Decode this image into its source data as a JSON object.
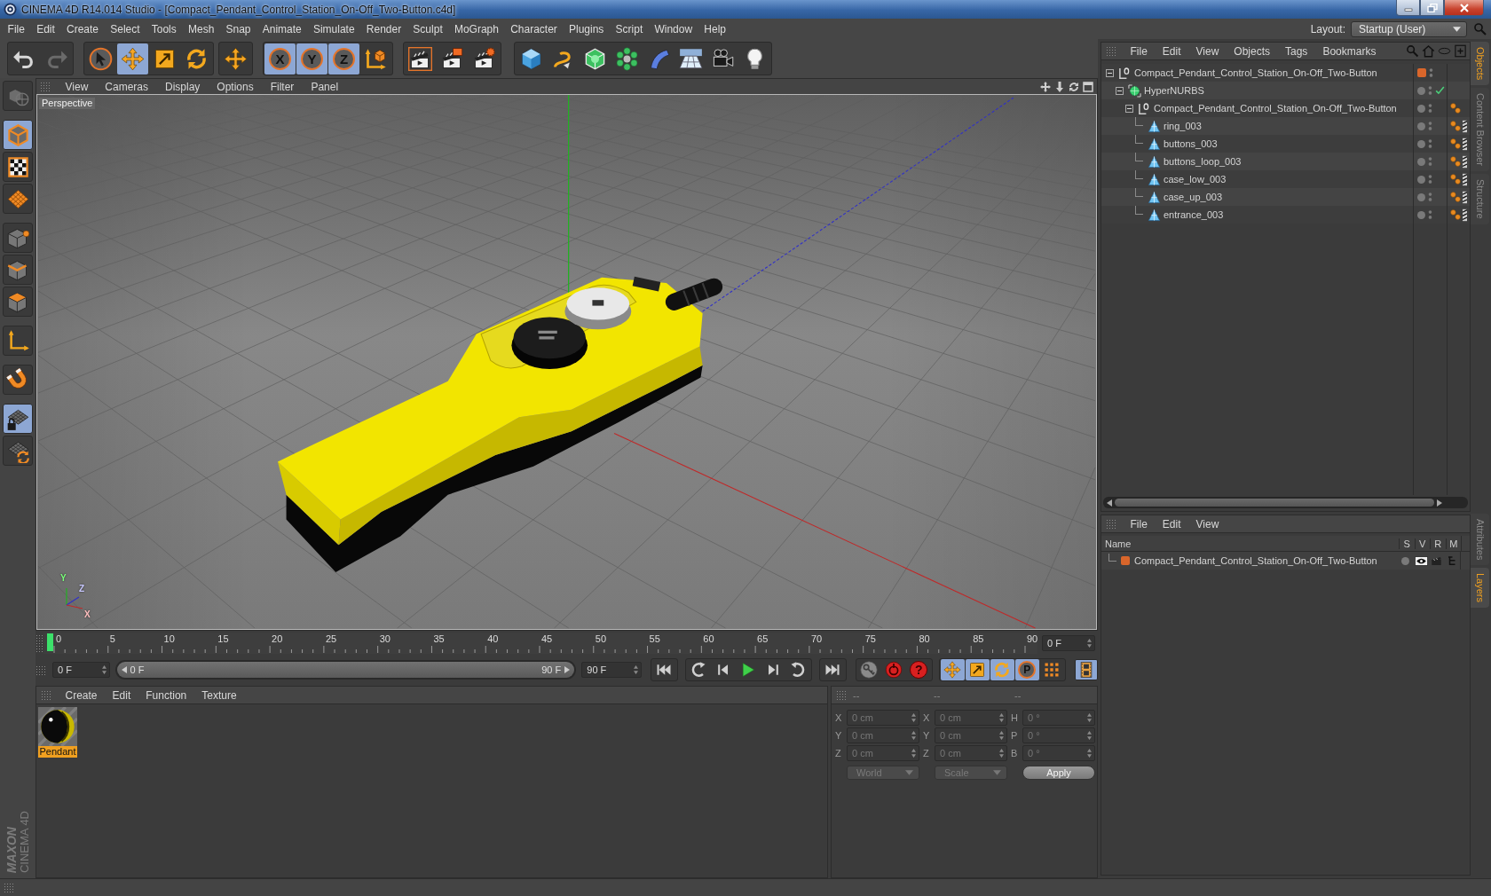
{
  "title_bar": {
    "title": "CINEMA 4D R14.014 Studio - [Compact_Pendant_Control_Station_On-Off_Two-Button.c4d]"
  },
  "menu_bar": {
    "items": [
      "File",
      "Edit",
      "Create",
      "Select",
      "Tools",
      "Mesh",
      "Snap",
      "Animate",
      "Simulate",
      "Render",
      "Sculpt",
      "MoGraph",
      "Character",
      "Plugins",
      "Script",
      "Window",
      "Help"
    ],
    "layout_label": "Layout:",
    "layout_value": "Startup (User)"
  },
  "toolbar": {
    "history": [
      {
        "disabled": false
      },
      {
        "disabled": true
      }
    ],
    "tools": [
      {
        "selected": false
      },
      {
        "selected": true
      },
      {
        "selected": false
      },
      {
        "selected": false
      }
    ],
    "axes": [
      {
        "label": "X",
        "selected": true
      },
      {
        "label": "Y",
        "selected": true
      },
      {
        "label": "Z",
        "selected": true
      }
    ]
  },
  "mode_bar": [
    {
      "selected": false,
      "disabled": true
    },
    {
      "selected": true,
      "disabled": false
    },
    {
      "selected": false,
      "disabled": false
    },
    {
      "selected": false,
      "disabled": false
    },
    {
      "selected": false,
      "disabled": false
    },
    {
      "selected": false,
      "disabled": false
    },
    {
      "selected": false,
      "disabled": false
    },
    {
      "selected": false,
      "disabled": false
    },
    {
      "selected": false,
      "disabled": false
    },
    {
      "selected": true,
      "disabled": false
    },
    {
      "selected": false,
      "disabled": false
    }
  ],
  "viewport": {
    "menu": [
      "View",
      "Cameras",
      "Display",
      "Options",
      "Filter",
      "Panel"
    ],
    "camera_label": "Perspective",
    "gizmo_labels": [
      "Y",
      "Z",
      "X"
    ]
  },
  "timeline": {
    "ticks": [
      "0",
      "5",
      "10",
      "15",
      "20",
      "25",
      "30",
      "35",
      "40",
      "45",
      "50",
      "55",
      "60",
      "65",
      "70",
      "75",
      "80",
      "85",
      "90"
    ],
    "playhead": {
      "level": 0
    },
    "current_frame": "0 F"
  },
  "transport": {
    "start_frame": "0 F",
    "range": {
      "start": "0 F",
      "end": "90 F",
      "level": 1
    },
    "end_frame": "90 F",
    "autokey_glyph": "?",
    "key_filters": [
      {
        "selected": true
      },
      {
        "selected": true
      },
      {
        "selected": true
      },
      {
        "selected": true
      },
      {
        "selected": false
      }
    ],
    "parameter_label": "P",
    "timeline_toggle": {
      "selected": true
    }
  },
  "materials": {
    "menu": [
      "Create",
      "Edit",
      "Function",
      "Texture"
    ],
    "items": [
      {
        "name": "Pendant",
        "selected": true
      }
    ]
  },
  "coordinates": {
    "headers": [
      "--",
      "--",
      "--"
    ],
    "disabled": true,
    "rows": [
      {
        "position_axis": "X",
        "position": "0 cm",
        "size_axis": "X",
        "size": "0 cm",
        "rotation_axis": "H",
        "rotation": "0 °"
      },
      {
        "position_axis": "Y",
        "position": "0 cm",
        "size_axis": "Y",
        "size": "0 cm",
        "rotation_axis": "P",
        "rotation": "0 °"
      },
      {
        "position_axis": "Z",
        "position": "0 cm",
        "size_axis": "Z",
        "size": "0 cm",
        "rotation_axis": "B",
        "rotation": "0 °"
      }
    ],
    "mode": "World",
    "transform": "Scale",
    "apply": "Apply"
  },
  "object_manager": {
    "menu": [
      "File",
      "Edit",
      "View",
      "Objects",
      "Tags",
      "Bookmarks"
    ],
    "objects": [
      {
        "kind": "null",
        "name": "Compact_Pendant_Control_Station_On-Off_Two-Button",
        "color": "#d9662b",
        "expanded": true,
        "tagged": false,
        "textured": false,
        "children": [
          {
            "kind": "generator",
            "name": "HyperNURBS",
            "enabled": true,
            "expanded": true,
            "tagged": false,
            "textured": false,
            "children": [
              {
                "kind": "null",
                "name": "Compact_Pendant_Control_Station_On-Off_Two-Button",
                "expanded": true,
                "tagged": true,
                "textured": false,
                "children": [
                  {
                    "kind": "polygon",
                    "name": "ring_003",
                    "tagged": true,
                    "textured": true
                  },
                  {
                    "kind": "polygon",
                    "name": "buttons_003",
                    "tagged": true,
                    "textured": true
                  },
                  {
                    "kind": "polygon",
                    "name": "buttons_loop_003",
                    "tagged": true,
                    "textured": true
                  },
                  {
                    "kind": "polygon",
                    "name": "case_low_003",
                    "tagged": true,
                    "textured": true
                  },
                  {
                    "kind": "polygon",
                    "name": "case_up_003",
                    "tagged": true,
                    "textured": true
                  },
                  {
                    "kind": "polygon",
                    "name": "entrance_003",
                    "tagged": true,
                    "textured": true
                  }
                ]
              }
            ]
          }
        ]
      }
    ]
  },
  "layer_manager": {
    "menu": [
      "File",
      "Edit",
      "View"
    ],
    "columns": [
      "Name",
      "S",
      "V",
      "R",
      "M"
    ],
    "layers": [
      {
        "name": "Compact_Pendant_Control_Station_On-Off_Two-Button",
        "color": "#d9662b",
        "solo": false,
        "visible": true,
        "render": true,
        "manager": true
      }
    ]
  },
  "side_tabs": {
    "top": [
      {
        "label": "Objects",
        "selected": true
      },
      {
        "label": "Content Browser",
        "selected": false
      },
      {
        "label": "Structure",
        "selected": false
      }
    ],
    "bottom": [
      {
        "label": "Attributes",
        "selected": false
      },
      {
        "label": "Layers",
        "selected": true
      }
    ]
  },
  "branding": {
    "company": "MAXON",
    "product": "CINEMA 4D"
  }
}
